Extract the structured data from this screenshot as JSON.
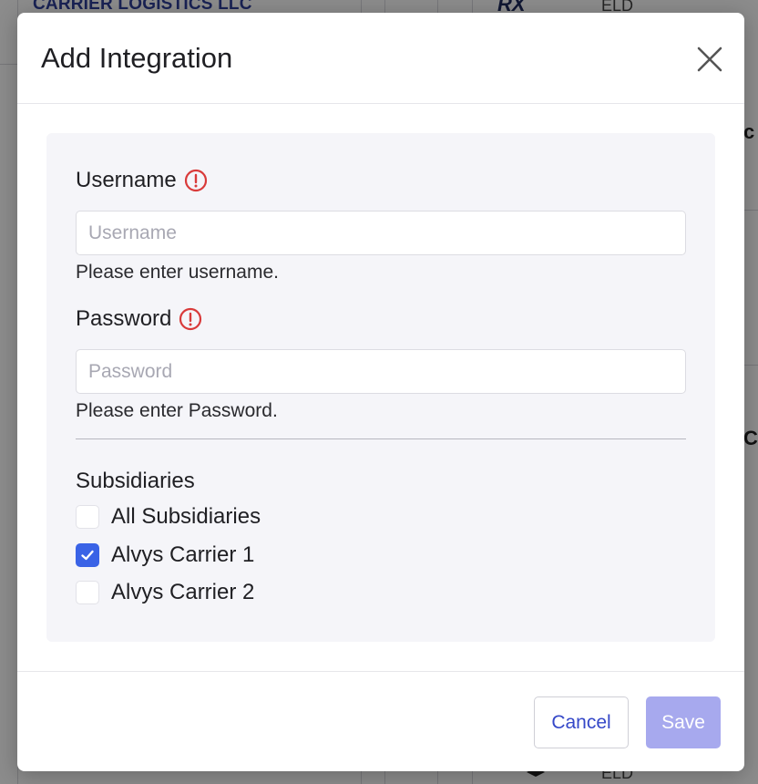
{
  "background": {
    "company_name": "CARRIER LOGISTICS LLC",
    "logo_text": "RX",
    "eld_label_top": "ELD",
    "eld_label_bottom": "ELD",
    "edge_text_1": "c",
    "edge_text_2": "C"
  },
  "modal": {
    "title": "Add Integration",
    "close_icon": "close-icon",
    "username": {
      "label": "Username",
      "placeholder": "Username",
      "value": "",
      "helper": "Please enter username.",
      "status_icon": "warning-circle-icon"
    },
    "password": {
      "label": "Password",
      "placeholder": "Password",
      "value": "",
      "helper": "Please enter Password.",
      "status_icon": "warning-circle-icon"
    },
    "subsidiaries": {
      "title": "Subsidiaries",
      "items": [
        {
          "label": "All Subsidiaries",
          "checked": false
        },
        {
          "label": "Alvys Carrier 1",
          "checked": true
        },
        {
          "label": "Alvys Carrier 2",
          "checked": false
        }
      ]
    },
    "footer": {
      "cancel_label": "Cancel",
      "save_label": "Save",
      "save_enabled": false
    }
  },
  "colors": {
    "accent": "#3a63e6",
    "error": "#d93a3a",
    "save_disabled": "#a7a9ee",
    "cancel_text": "#3548c8"
  }
}
